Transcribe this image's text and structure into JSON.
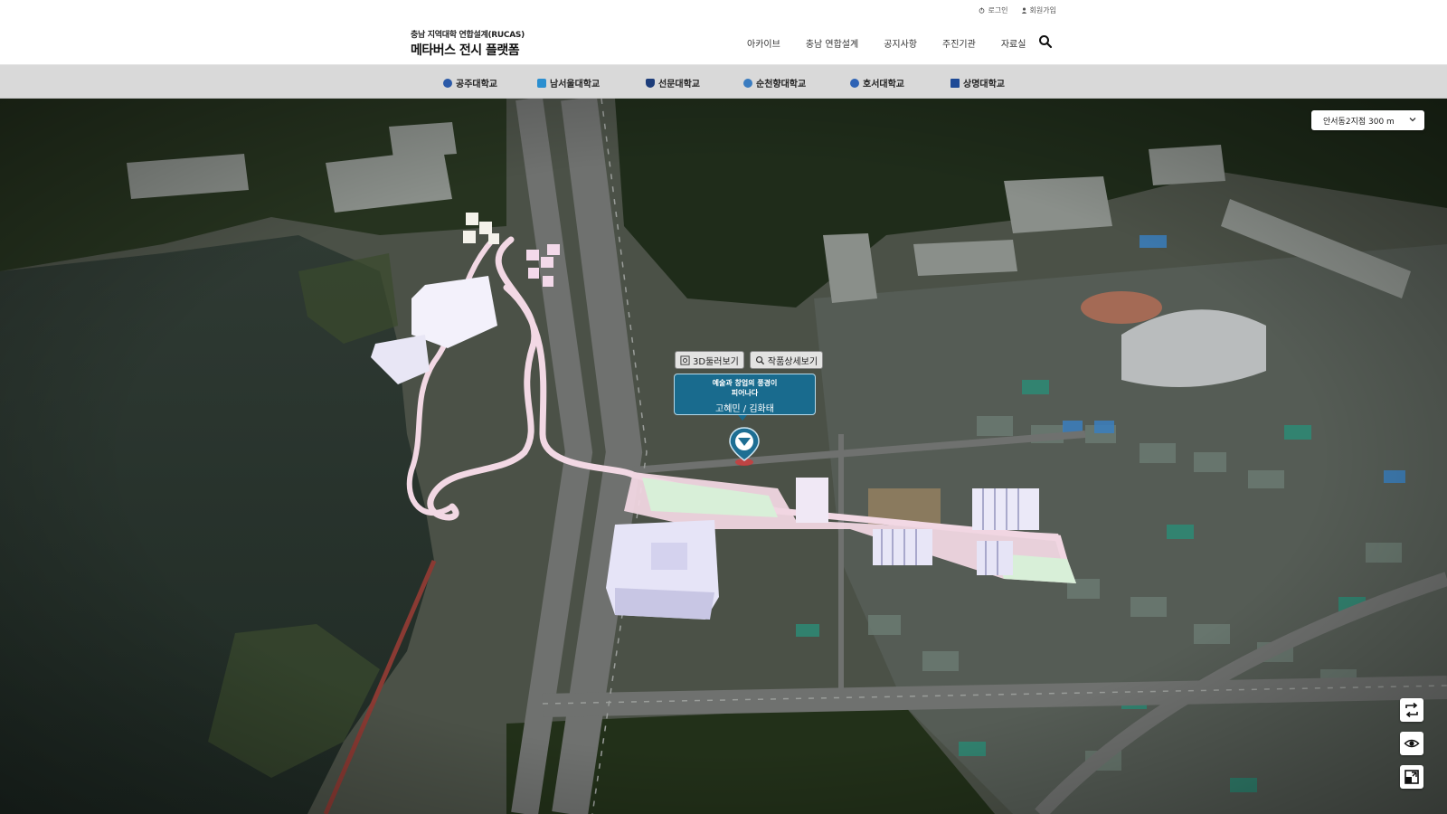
{
  "header": {
    "util": [
      {
        "label": "로그인",
        "icon": "power-icon"
      },
      {
        "label": "회원가입",
        "icon": "user-icon"
      }
    ],
    "logo": {
      "subtitle": "충남 지역대학 연합설계(RUCAS)",
      "title": "메타버스 전시 플랫폼"
    },
    "nav": [
      "아카이브",
      "충남 연합설계",
      "공지사항",
      "주진기관",
      "자료실"
    ],
    "search_icon": "search-icon"
  },
  "universities": [
    {
      "label": "공주대학교",
      "color": "#2b5aa8"
    },
    {
      "label": "남서울대학교",
      "color": "#2b8fd0"
    },
    {
      "label": "선문대학교",
      "color": "#1d3d7a"
    },
    {
      "label": "순천향대학교",
      "color": "#3a7cc0"
    },
    {
      "label": "호서대학교",
      "color": "#2e63b5"
    },
    {
      "label": "상명대학교",
      "color": "#1e4a96"
    }
  ],
  "map": {
    "location_select": "안서동2지점 300 m",
    "buttons": {
      "view3d": "3D둘러보기",
      "detail": "작품상세보기"
    },
    "card": {
      "title": "예술과 창업의 풍경이\n피어나다",
      "authors": "고혜민  /  김화태"
    },
    "side_icons": [
      "rotate-icon",
      "eye-icon",
      "minimap-icon"
    ],
    "colors": {
      "accent": "#146e96",
      "path": "#f2d8e4",
      "building": "#e6e4f7"
    }
  }
}
